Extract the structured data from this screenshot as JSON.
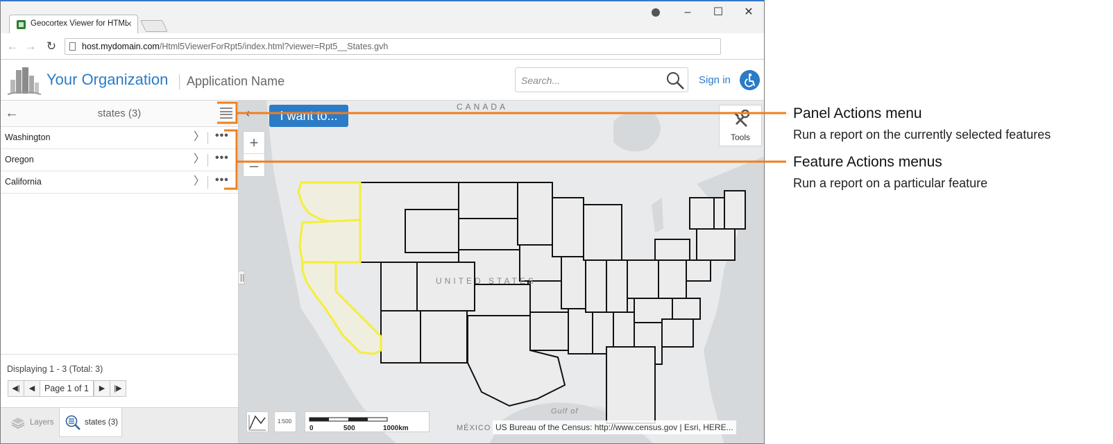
{
  "browser": {
    "tab_title": "Geocortex Viewer for HTML5",
    "tab_close": "×",
    "url_host": "host.mydomain.com",
    "url_path": "/Html5ViewerForRpt5/index.html?viewer=Rpt5__States.gvh",
    "controls": {
      "minimize": "–",
      "maximize": "☐",
      "close": "✕"
    }
  },
  "header": {
    "org_name": "Your Organization",
    "app_name": "Application Name",
    "search_placeholder": "Search...",
    "sign_in": "Sign in"
  },
  "panel": {
    "title": "states (3)",
    "features": [
      {
        "name": "Washington"
      },
      {
        "name": "Oregon"
      },
      {
        "name": "California"
      }
    ],
    "chevron": "〉",
    "more": "•••",
    "displaying": "Displaying 1 - 3 (Total: 3)",
    "pager": {
      "label": "Page 1 of 1"
    },
    "tabs": [
      {
        "label": "Layers"
      },
      {
        "label": "states (3)"
      }
    ]
  },
  "map": {
    "iwant": "I want to...",
    "tools": "Tools",
    "labels": {
      "canada": "CANADA",
      "us": "UNITED STATES",
      "gulf": "Gulf of",
      "mexico": "MÉXICO"
    },
    "scale_button": "1:500",
    "scale_ticks": [
      "0",
      "500",
      "1000km"
    ],
    "attribution": "US Bureau of the Census: http://www.census.gov | Esri, HERE...",
    "colors": {
      "selection": "#f5ee3a",
      "selection_fill": "#f0efdf",
      "accent": "#f07f1e"
    }
  },
  "callouts": [
    {
      "title": "Panel Actions menu",
      "desc": "Run a report on the currently selected features"
    },
    {
      "title": "Feature Actions menus",
      "desc": "Run a report on a particular feature"
    }
  ]
}
